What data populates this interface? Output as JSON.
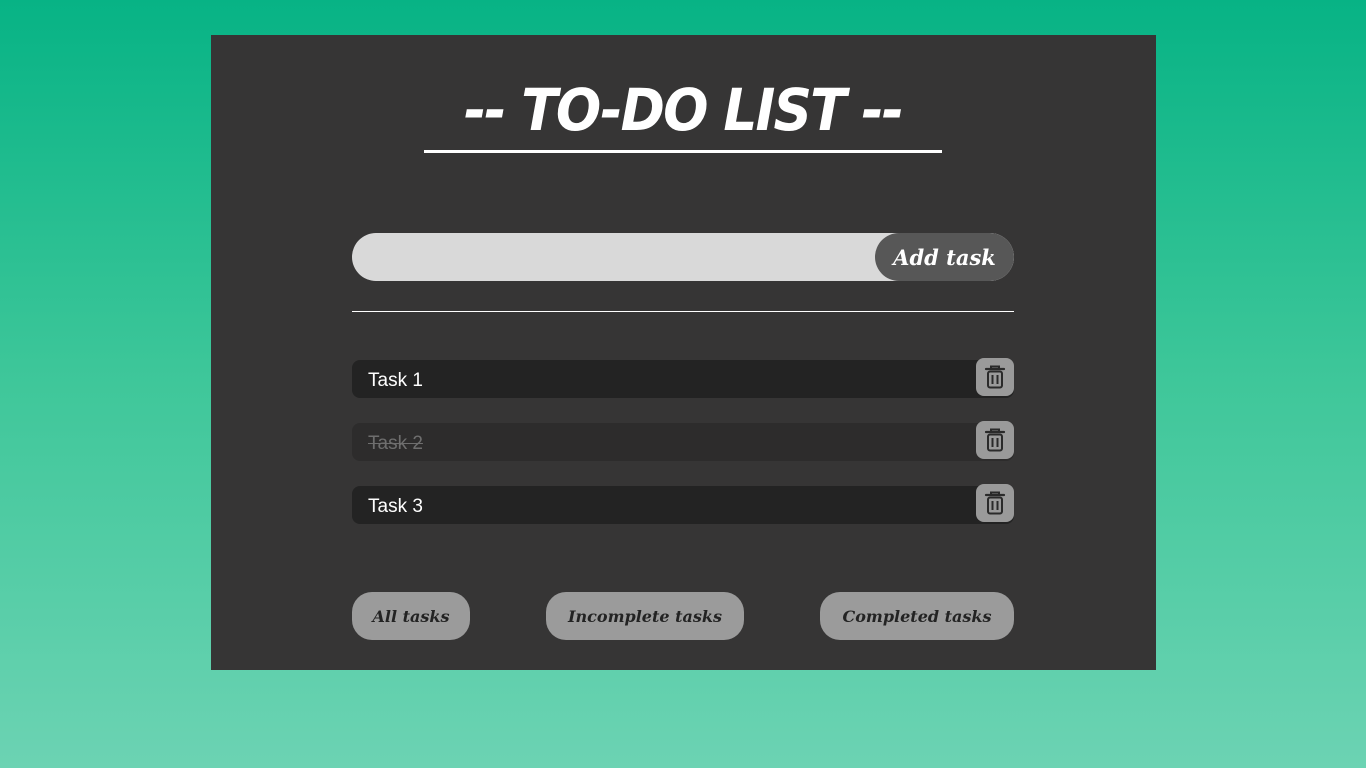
{
  "app": {
    "title": "-- TO-DO LIST --"
  },
  "add_form": {
    "input_value": "",
    "placeholder": "",
    "button_label": "Add task"
  },
  "tasks": [
    {
      "text": "Task 1",
      "completed": false
    },
    {
      "text": "Task 2",
      "completed": true
    },
    {
      "text": "Task 3",
      "completed": false
    }
  ],
  "task_icons": {
    "delete": "trash-icon"
  },
  "filters": {
    "all_label": "All tasks",
    "incomplete_label": "Incomplete tasks",
    "completed_label": "Completed tasks"
  },
  "colors": {
    "background_top": "#07b385",
    "background_bottom": "#6cd3b3",
    "panel": "#363535",
    "task_bg": "#232323",
    "button_gray": "#9b9b9b",
    "add_button": "#575757"
  }
}
